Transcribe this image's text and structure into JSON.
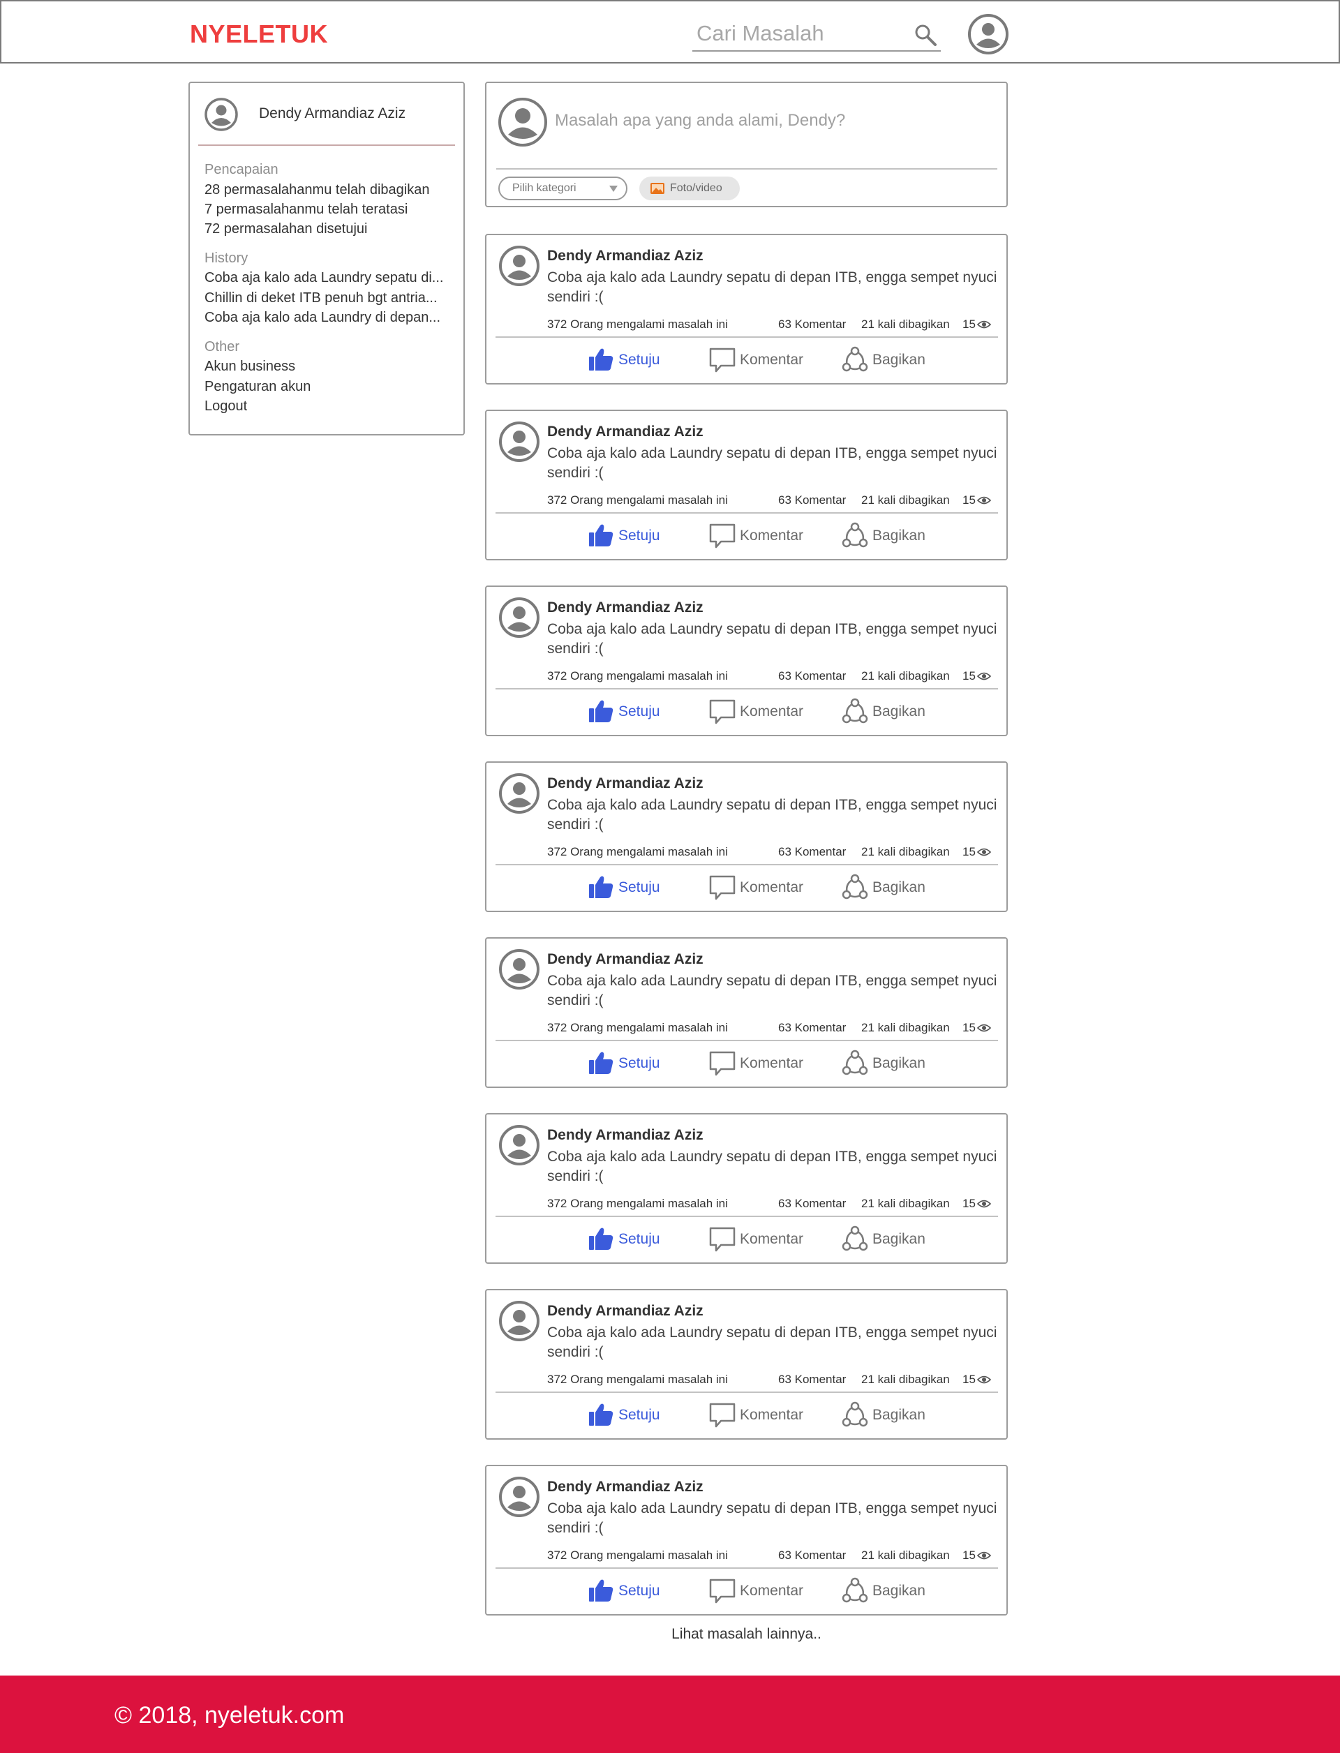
{
  "header": {
    "logo": "NYELETUK",
    "search_placeholder": "Cari Masalah"
  },
  "sidebar": {
    "user_name": "Dendy Armandiaz Aziz",
    "achievements": {
      "heading": "Pencapaian",
      "items": [
        "28 permasalahanmu telah dibagikan",
        "7 permasalahanmu telah teratasi",
        "72 permasalahan disetujui"
      ]
    },
    "history": {
      "heading": "History",
      "items": [
        "Coba aja kalo ada Laundry sepatu di...",
        "Chillin di deket ITB penuh bgt antria...",
        "Coba aja kalo ada Laundry di depan..."
      ]
    },
    "other": {
      "heading": "Other",
      "items": [
        "Akun business",
        "Pengaturan akun",
        "Logout"
      ]
    }
  },
  "composer": {
    "placeholder": "Masalah apa yang anda alami, Dendy?",
    "category_label": "Pilih kategori",
    "media_label": "Foto/video"
  },
  "posts": [
    {
      "author": "Dendy Armandiaz Aziz",
      "text": "Coba aja kalo ada Laundry sepatu di depan ITB, engga sempet nyuci sendiri :(",
      "affected": "372 Orang mengalami masalah ini",
      "comments": "63 Komentar",
      "shares": "21 kali dibagikan",
      "views": "15",
      "agree_label": "Setuju",
      "comment_label": "Komentar",
      "share_label": "Bagikan"
    },
    {
      "author": "Dendy Armandiaz Aziz",
      "text": "Coba aja kalo ada Laundry sepatu di depan ITB, engga sempet nyuci sendiri :(",
      "affected": "372 Orang mengalami masalah ini",
      "comments": "63 Komentar",
      "shares": "21 kali dibagikan",
      "views": "15",
      "agree_label": "Setuju",
      "comment_label": "Komentar",
      "share_label": "Bagikan"
    },
    {
      "author": "Dendy Armandiaz Aziz",
      "text": "Coba aja kalo ada Laundry sepatu di depan ITB, engga sempet nyuci sendiri :(",
      "affected": "372 Orang mengalami masalah ini",
      "comments": "63 Komentar",
      "shares": "21 kali dibagikan",
      "views": "15",
      "agree_label": "Setuju",
      "comment_label": "Komentar",
      "share_label": "Bagikan"
    },
    {
      "author": "Dendy Armandiaz Aziz",
      "text": "Coba aja kalo ada Laundry sepatu di depan ITB, engga sempet nyuci sendiri :(",
      "affected": "372 Orang mengalami masalah ini",
      "comments": "63 Komentar",
      "shares": "21 kali dibagikan",
      "views": "15",
      "agree_label": "Setuju",
      "comment_label": "Komentar",
      "share_label": "Bagikan"
    },
    {
      "author": "Dendy Armandiaz Aziz",
      "text": "Coba aja kalo ada Laundry sepatu di depan ITB, engga sempet nyuci sendiri :(",
      "affected": "372 Orang mengalami masalah ini",
      "comments": "63 Komentar",
      "shares": "21 kali dibagikan",
      "views": "15",
      "agree_label": "Setuju",
      "comment_label": "Komentar",
      "share_label": "Bagikan"
    },
    {
      "author": "Dendy Armandiaz Aziz",
      "text": "Coba aja kalo ada Laundry sepatu di depan ITB, engga sempet nyuci sendiri :(",
      "affected": "372 Orang mengalami masalah ini",
      "comments": "63 Komentar",
      "shares": "21 kali dibagikan",
      "views": "15",
      "agree_label": "Setuju",
      "comment_label": "Komentar",
      "share_label": "Bagikan"
    },
    {
      "author": "Dendy Armandiaz Aziz",
      "text": "Coba aja kalo ada Laundry sepatu di depan ITB, engga sempet nyuci sendiri :(",
      "affected": "372 Orang mengalami masalah ini",
      "comments": "63 Komentar",
      "shares": "21 kali dibagikan",
      "views": "15",
      "agree_label": "Setuju",
      "comment_label": "Komentar",
      "share_label": "Bagikan"
    },
    {
      "author": "Dendy Armandiaz Aziz",
      "text": "Coba aja kalo ada Laundry sepatu di depan ITB, engga sempet nyuci sendiri :(",
      "affected": "372 Orang mengalami masalah ini",
      "comments": "63 Komentar",
      "shares": "21 kali dibagikan",
      "views": "15",
      "agree_label": "Setuju",
      "comment_label": "Komentar",
      "share_label": "Bagikan"
    }
  ],
  "more_label": "Lihat masalah lainnya..",
  "footer": {
    "text": "© 2018, nyeletuk.com"
  },
  "colors": {
    "brand": "#ee3e3e",
    "footer": "#dc123e",
    "agree": "#3b5bdb",
    "icon_gray": "#7a7a7a"
  },
  "icons": {
    "search": "search-icon",
    "avatar": "avatar-icon",
    "agree": "thumbs-up-icon",
    "comment": "speech-bubble-icon",
    "share": "share-nodes-icon",
    "views": "eye-icon",
    "media": "image-icon"
  }
}
